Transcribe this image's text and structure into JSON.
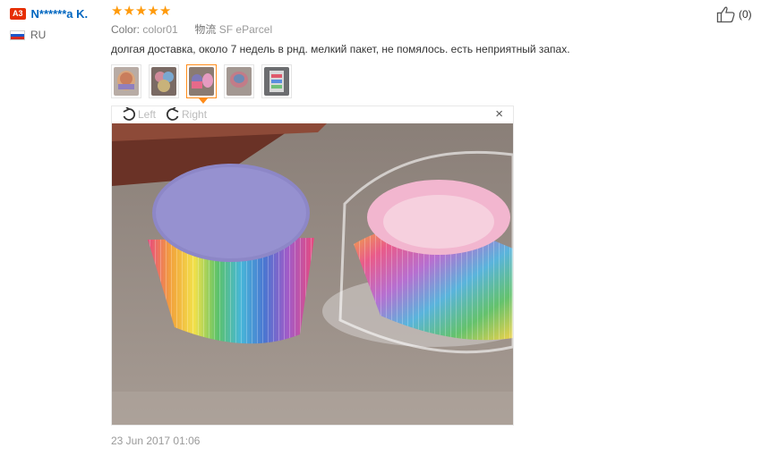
{
  "user": {
    "level_badge": "A3",
    "name": "N******a K.",
    "country": "RU"
  },
  "review": {
    "rating": 5,
    "stars": [
      "★",
      "★",
      "★",
      "★",
      "★"
    ],
    "color_label": "Color:",
    "color_value": "color01",
    "shipping_label": "物流",
    "shipping_value": "SF eParcel",
    "text": "долгая доставка, около 7 недель в рнд. мелкий пакет, не помялось. есть неприятный запах.",
    "date": "23 Jun 2017 01:06",
    "helpful_count": "(0)"
  },
  "thumbnails": {
    "count": 5,
    "selected_index": 2
  },
  "viewer": {
    "rotate_left_label": "Left",
    "rotate_right_label": "Right",
    "close_glyph": "×"
  },
  "colors": {
    "star": "#ff9a0b",
    "username": "#0066c0",
    "badge": "#e62e04",
    "active_thumb": "#ff8c1a"
  }
}
